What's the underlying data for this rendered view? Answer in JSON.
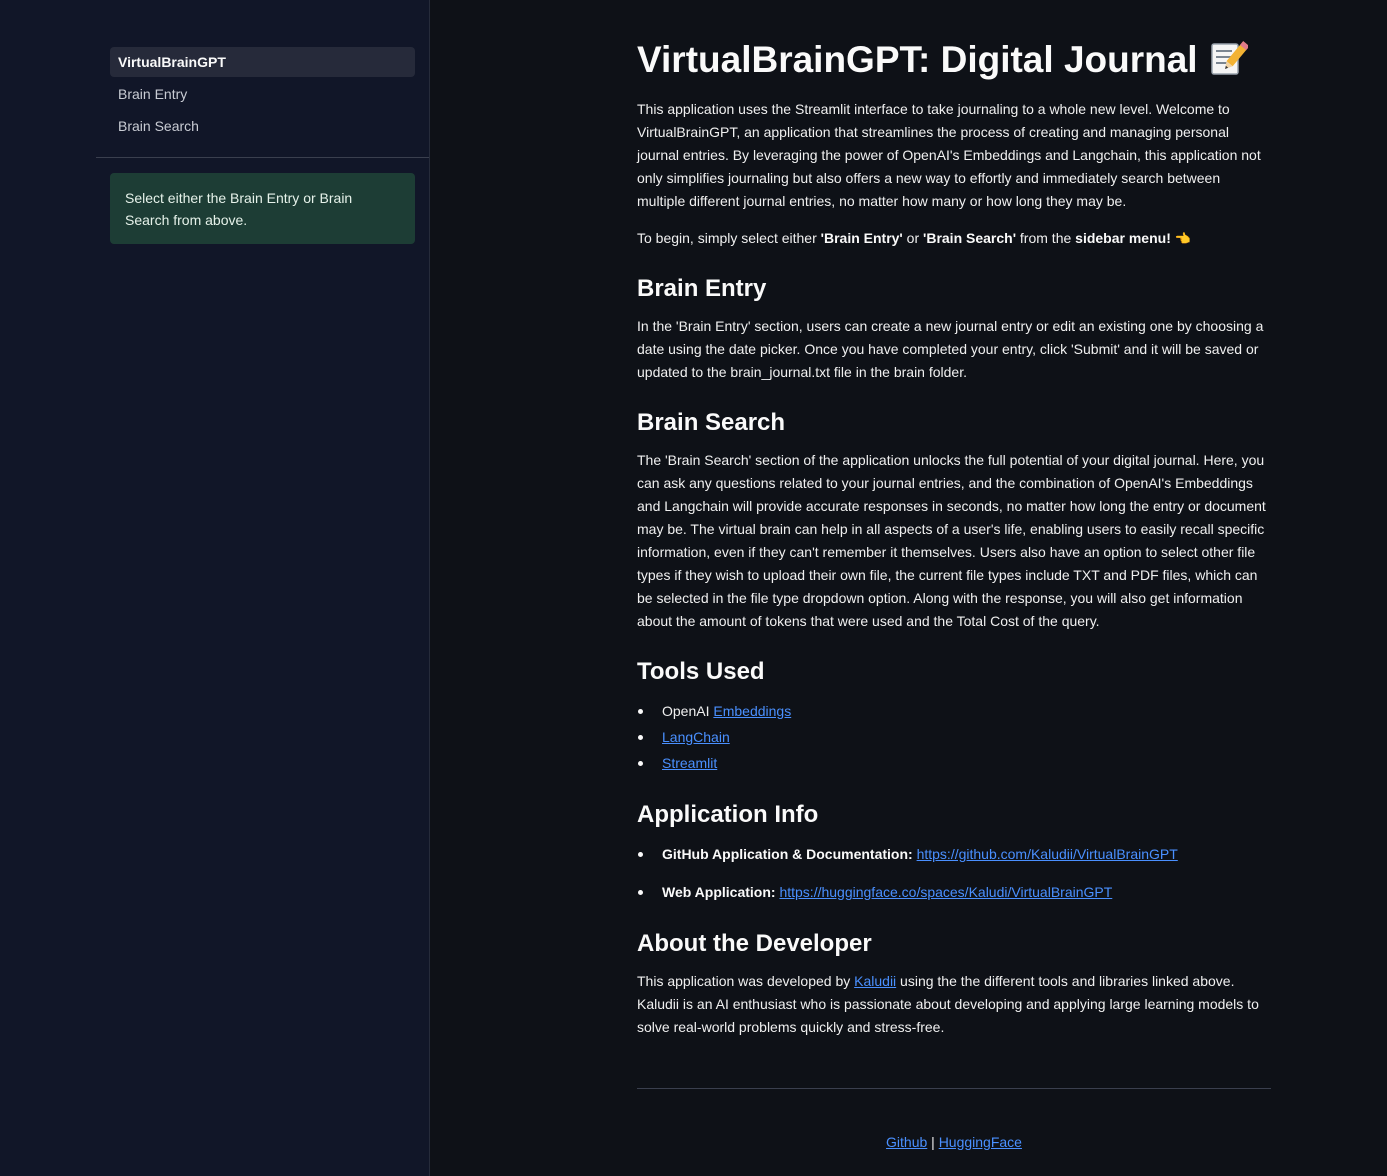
{
  "sidebar": {
    "nav_items": [
      {
        "label": "VirtualBrainGPT",
        "active": true
      },
      {
        "label": "Brain Entry",
        "active": false
      },
      {
        "label": "Brain Search",
        "active": false
      }
    ],
    "info_message": "Select either the Brain Entry or Brain Search from above."
  },
  "main": {
    "title": "VirtualBrainGPT: Digital Journal",
    "title_icon": "memo-pencil-icon",
    "intro": "This application uses the Streamlit interface to take journaling to a whole new level. Welcome to VirtualBrainGPT, an application that streamlines the process of creating and managing personal journal entries. By leveraging the power of OpenAI's Embeddings and Langchain, this application not only simplifies journaling but also offers a new way to effortly and immediately search between multiple different journal entries, no matter how many or how long they may be.",
    "begin": {
      "prefix": "To begin, simply select either ",
      "entry": "'Brain Entry'",
      "or": " or ",
      "search": "'Brain Search'",
      "from": " from the ",
      "menu": "sidebar menu!",
      "icon": "pointing-left-hand-icon"
    },
    "brain_entry": {
      "heading": "Brain Entry",
      "text": "In the 'Brain Entry' section, users can create a new journal entry or edit an existing one by choosing a date using the date picker. Once you have completed your entry, click 'Submit' and it will be saved or updated to the brain_journal.txt file in the brain folder."
    },
    "brain_search": {
      "heading": "Brain Search",
      "text": "The 'Brain Search' section of the application unlocks the full potential of your digital journal. Here, you can ask any questions related to your journal entries, and the combination of OpenAI's Embeddings and Langchain will provide accurate responses in seconds, no matter how long the entry or document may be. The virtual brain can help in all aspects of a user's life, enabling users to easily recall specific information, even if they can't remember it themselves. Users also have an option to select other file types if they wish to upload their own file, the current file types include TXT and PDF files, which can be selected in the file type dropdown option. Along with the response, you will also get information about the amount of tokens that were used and the Total Cost of the query."
    },
    "tools": {
      "heading": "Tools Used",
      "item1_prefix": "OpenAI ",
      "item1_link": "Embeddings",
      "item2_link": "LangChain",
      "item3_link": "Streamlit"
    },
    "app_info": {
      "heading": "Application Info",
      "github_label": "GitHub Application & Documentation:",
      "github_url": "https://github.com/Kaludii/VirtualBrainGPT",
      "web_label": "Web Application:",
      "web_url": "https://huggingface.co/spaces/Kaludi/VirtualBrainGPT"
    },
    "developer": {
      "heading": "About the Developer",
      "prefix": "This application was developed by ",
      "link": "Kaludii",
      "suffix": " using the the different tools and libraries linked above. Kaludii is an AI enthusiast who is passionate about developing and applying large learning models to solve real-world problems quickly and stress-free."
    },
    "footer": {
      "github": "Github",
      "separator": "|",
      "huggingface": "HuggingFace"
    }
  },
  "colors": {
    "background": "#0e1117",
    "sidebar": "#111628",
    "info_box": "#1d3d35",
    "link": "#4a90ff"
  }
}
